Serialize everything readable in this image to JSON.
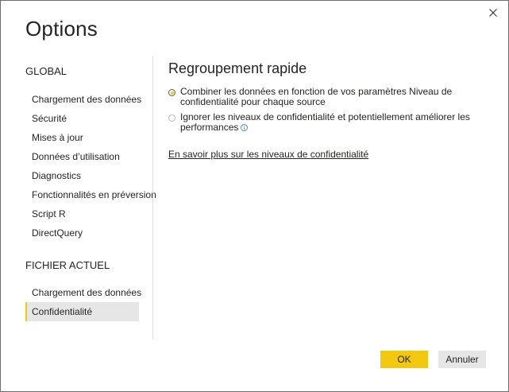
{
  "dialog": {
    "title": "Options",
    "close_icon": "close-icon"
  },
  "sidebar": {
    "global_header": "GLOBAL",
    "global_items": [
      {
        "label": "Chargement des données"
      },
      {
        "label": "Sécurité"
      },
      {
        "label": "Mises à jour"
      },
      {
        "label": "Données d’utilisation"
      },
      {
        "label": "Diagnostics"
      },
      {
        "label": "Fonctionnalités en préversion"
      },
      {
        "label": "Script R"
      },
      {
        "label": "DirectQuery"
      }
    ],
    "current_header": "FICHIER ACTUEL",
    "current_items": [
      {
        "label": "Chargement des données",
        "selected": false
      },
      {
        "label": "Confidentialité",
        "selected": true
      }
    ]
  },
  "content": {
    "title": "Regroupement rapide",
    "options": [
      {
        "label": "Combiner les données en fonction de vos paramètres Niveau de confidentialité pour chaque source",
        "checked": true
      },
      {
        "label": "Ignorer les niveaux de confidentialité et potentiellement améliorer les performances",
        "checked": false,
        "icon": "info-icon"
      }
    ],
    "link": "En savoir plus sur les niveaux de confidentialité"
  },
  "buttons": {
    "ok": "OK",
    "cancel": "Annuler"
  },
  "colors": {
    "accent": "#f2c811",
    "selected_bg": "#e6e6e6",
    "text": "#252423"
  }
}
